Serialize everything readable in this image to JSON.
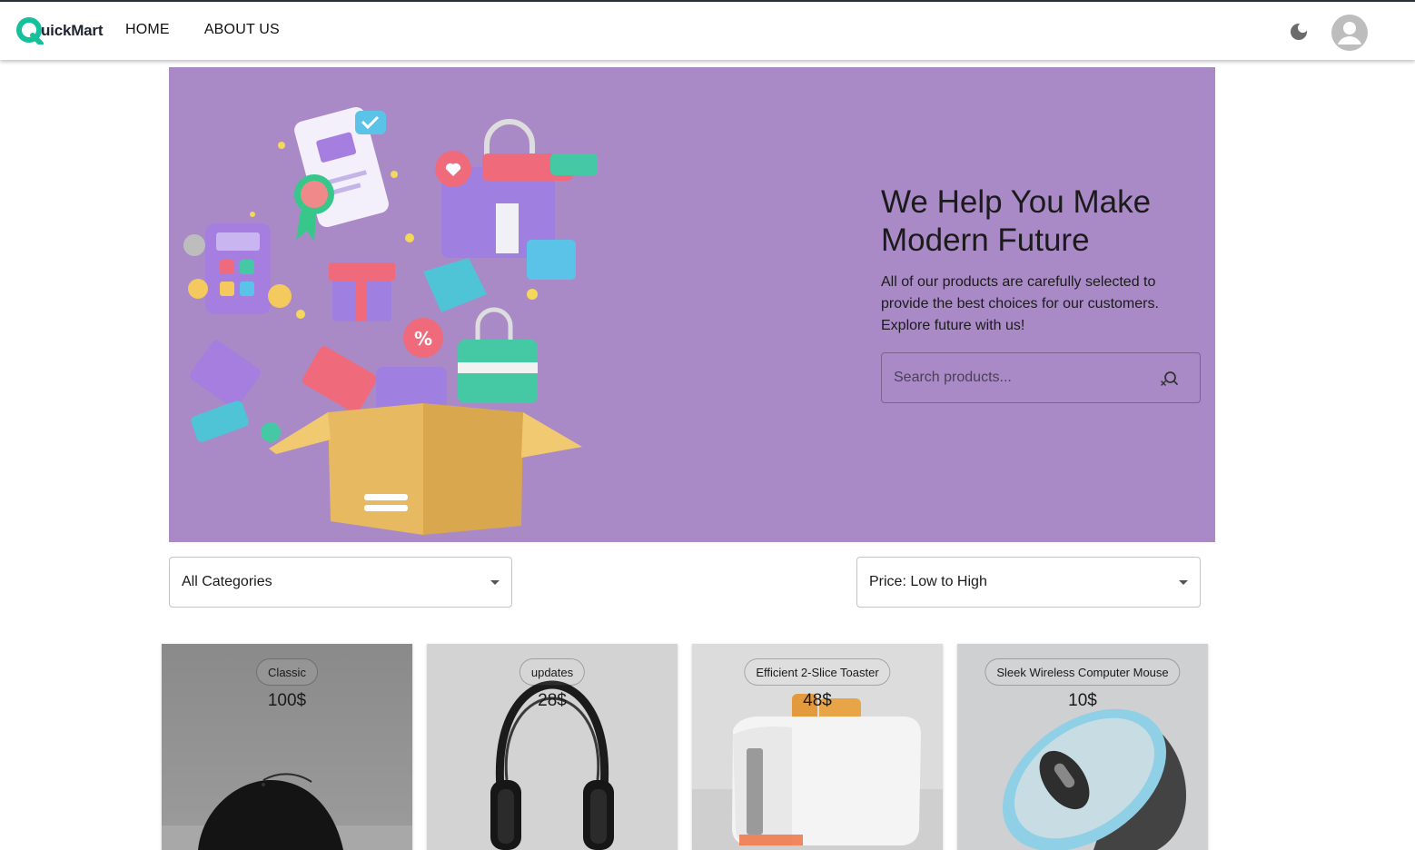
{
  "header": {
    "logo_text": "uickMart",
    "brand_color": "#16c09a",
    "nav": [
      {
        "label": "HOME"
      },
      {
        "label": "ABOUT US"
      }
    ],
    "theme_icon": "moon-icon",
    "avatar_icon": "account-circle-icon"
  },
  "hero": {
    "background_color": "#a98ac7",
    "title": "We Help You Make Modern Future",
    "description": "All of our products are carefully selected to provide the best choices for our customers. Explore future with us!",
    "search": {
      "placeholder": "Search products...",
      "value": ""
    }
  },
  "filters": {
    "category": {
      "selected": "All Categories"
    },
    "sort": {
      "selected": "Price: Low to High"
    }
  },
  "products": [
    {
      "name": "Classic",
      "price": "100$"
    },
    {
      "name": "updates",
      "price": "28$"
    },
    {
      "name": "Efficient 2-Slice Toaster",
      "price": "48$"
    },
    {
      "name": "Sleek Wireless Computer Mouse",
      "price": "10$"
    }
  ]
}
